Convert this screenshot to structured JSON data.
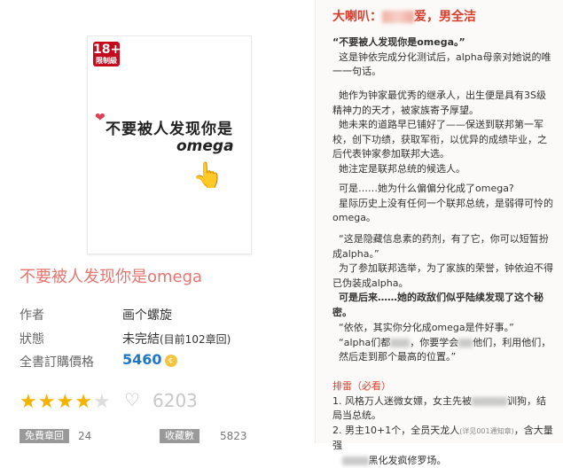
{
  "cover": {
    "rating_number": "18+",
    "rating_text": "限制級",
    "title_line1": "不要被人发现你是",
    "title_line2": "omega"
  },
  "book": {
    "title": "不要被人发现你是omega",
    "author_label": "作者",
    "author_value": "画个螺旋",
    "status_label": "狀態",
    "status_value": "未完結",
    "status_detail": "(目前102章回)",
    "price_label": "全書訂購價格",
    "price_value": "5460",
    "rating_stars": 4,
    "rating_max": 5,
    "favorite_count": "6203",
    "free_chapters_label": "免費章回",
    "free_chapters_value": "24",
    "collections_label": "收藏數",
    "collections_value": "5823"
  },
  "summary": {
    "heading_prefix": "大喇叭：",
    "heading_suffix": "爱，男全洁",
    "quote1": "“不要被人发现你是omega。”",
    "p1_rest": "这是钟依完成分化测试后，alpha母亲对她说的唯一一句话。",
    "p2a": "她作为钟家最优秀的继承人，出生便是具有3S级精神力的天才，被家族寄予厚望。",
    "p2b": "她未来的道路早已铺好了——保送到联邦第一军校，创下功绩，获取军衔，以优异的成绩毕业，之后代表钟家参加联邦大选。",
    "p2c": "她注定是联邦总统的候选人。",
    "p3a": "可是……她为什么偏偏分化成了omega?",
    "p3b": "星际历史上没有任何一个联邦总统，是弱得可怜的omega。",
    "p4a": "“这是隐藏信息素的药剂，有了它，你可以短暂扮成alpha。”",
    "p4b": "为了参加联邦选举，为了家族的荣誉，钟依迫不得已伪装成alpha。",
    "p4c": "可是后来……她的政敌们似乎陆续发现了这个秘密。",
    "p5a": "“依依，其实你分化成omega是件好事。”",
    "p5b_pre": "“alpha们都",
    "p5b_mid": "，你要学会",
    "p5b_post": "他们，利用他们，",
    "p5c": "然后走到那个最高的位置。”",
    "mine_title": "排雷（必看）",
    "m1_pre": "1. 风格万人迷微女嫖，女主先被",
    "m1_post": "训狗，结局当总统。",
    "m2_pre": "2. 男主10+1个，全员天龙人",
    "m2_small": "(详见001通知章)",
    "m2_post": "，含大量强",
    "m2b": "黑化发疯修罗场。"
  },
  "colors": {
    "accent_red": "#d93d2c",
    "title_pink": "#e8746f",
    "price_blue": "#1e78c8",
    "star_gold": "#f5b301"
  }
}
